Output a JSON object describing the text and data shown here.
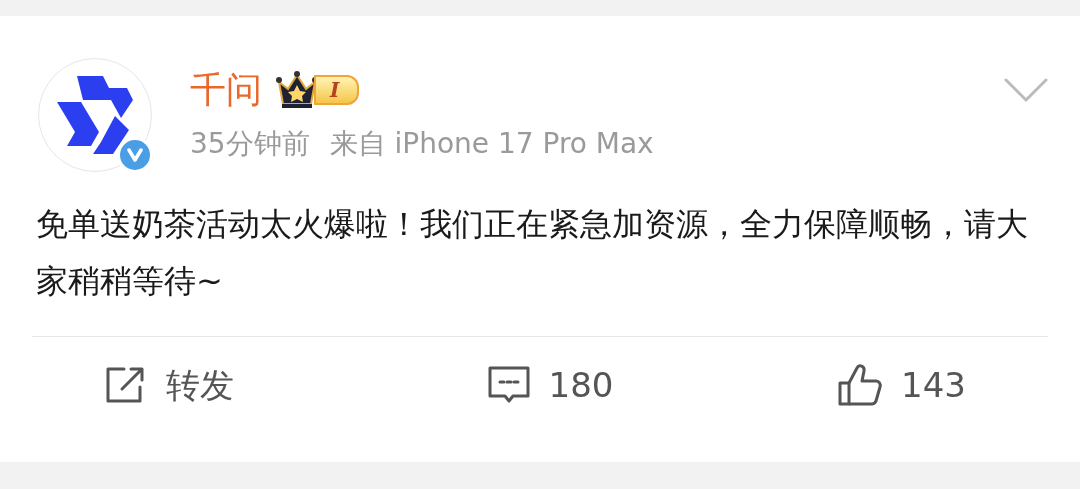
{
  "post": {
    "author": "千问",
    "badge_level": "I",
    "time": "35分钟前",
    "source": "来自 iPhone 17 Pro Max",
    "verified": true,
    "text": "免单送奶茶活动太火爆啦！我们正在紧急加资源，全力保障顺畅，请大家稍稍等待~"
  },
  "actions": [
    {
      "kind": "repost",
      "label": "转发"
    },
    {
      "kind": "comment",
      "label": "180"
    },
    {
      "kind": "like",
      "label": "143"
    }
  ]
}
